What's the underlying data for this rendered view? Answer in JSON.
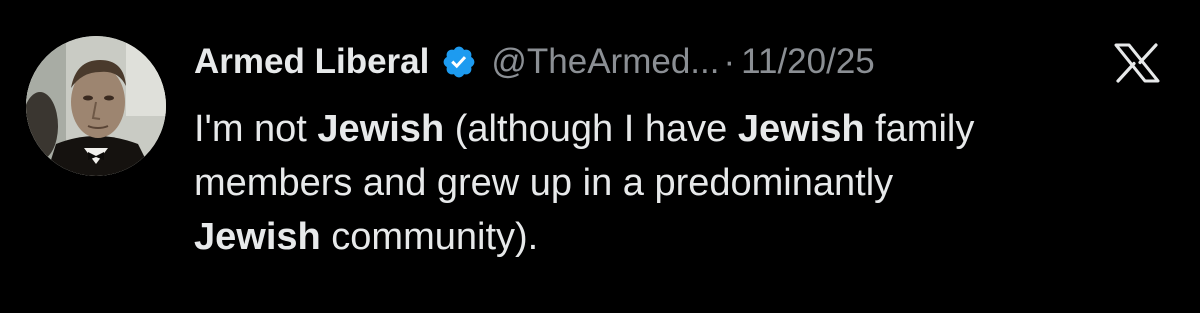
{
  "author": {
    "display_name": "Armed Liberal",
    "handle": "@TheArmed...",
    "separator": "·",
    "date": "11/20/25",
    "verified_icon": "verified-badge-icon",
    "avatar_icon": "profile-avatar"
  },
  "platform_icon": "x-logo-icon",
  "tweet": {
    "line1": {
      "t1": "I'm not ",
      "b1": "Jewish",
      "t2": " (although I have ",
      "b2": "Jewish",
      "t3": " family"
    },
    "line2": {
      "t1": "members and grew up in a predominantly"
    },
    "line3": {
      "b1": "Jewish",
      "t1": " community)."
    }
  },
  "colors": {
    "background": "#000000",
    "primary_text": "#e7e9ea",
    "secondary_text": "#8b8f94",
    "verified_blue": "#1d9bf0"
  }
}
